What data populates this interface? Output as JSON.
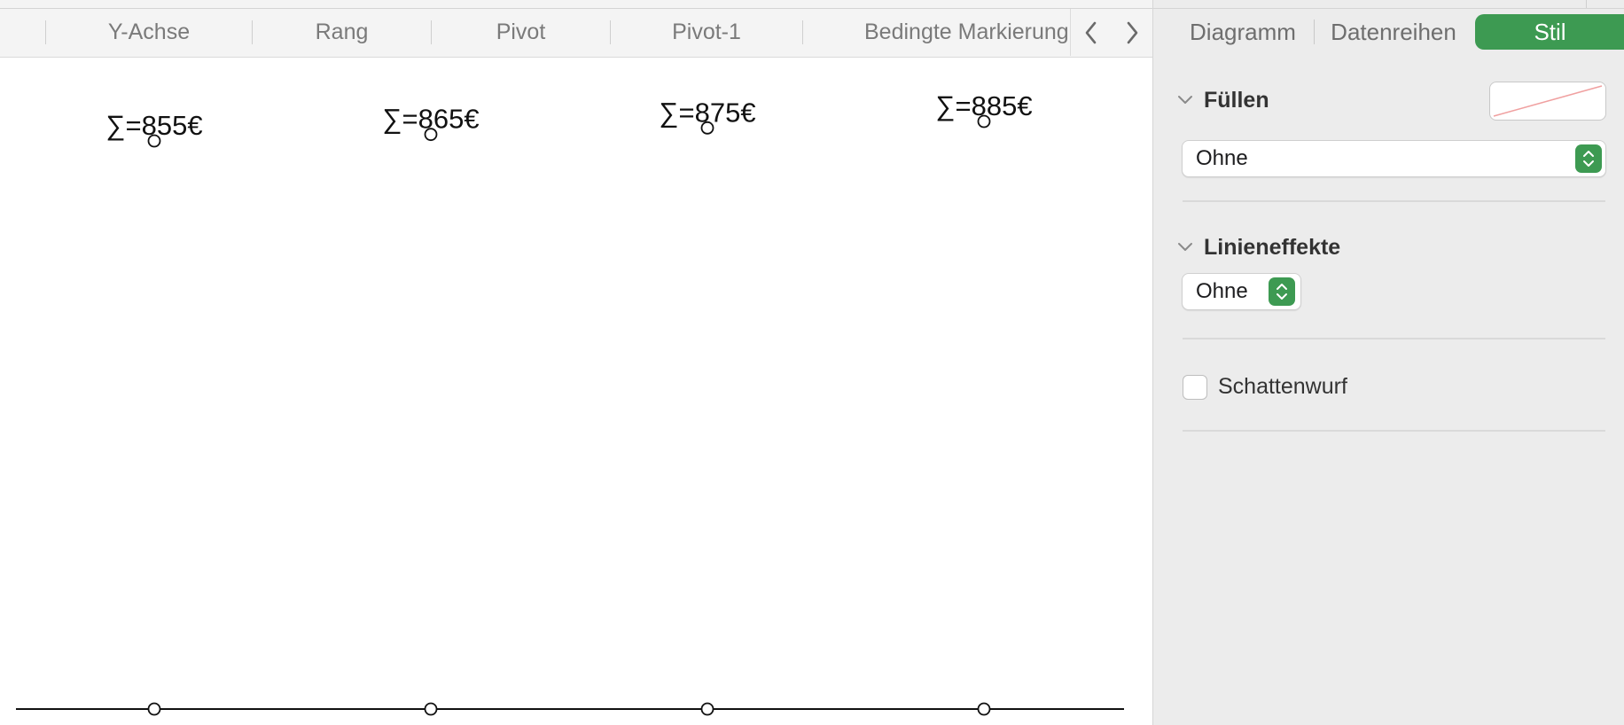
{
  "tabs": [
    {
      "label": "Y-Achse"
    },
    {
      "label": "Rang"
    },
    {
      "label": "Pivot"
    },
    {
      "label": "Pivot-1"
    },
    {
      "label": "Bedingte Markierung"
    }
  ],
  "nav": {
    "prev_icon": "chevron-left-icon",
    "next_icon": "chevron-right-icon"
  },
  "inspector": {
    "tabs": {
      "diagram": "Diagramm",
      "series": "Datenreihen",
      "style": "Stil"
    },
    "fill": {
      "label": "Füllen",
      "value": "Ohne"
    },
    "line_effects": {
      "label": "Linieneffekte",
      "value": "Ohne"
    },
    "shadow": {
      "label": "Schattenwurf",
      "checked": false
    }
  },
  "colors": {
    "accent": "#3d9a52",
    "panel": "#ececec",
    "no-fill-slash": "#f0a0a0"
  },
  "chart_data": {
    "type": "line",
    "categories": [
      "",
      "",
      "",
      ""
    ],
    "values": [
      855,
      865,
      875,
      885
    ],
    "data_labels": [
      "∑=855€",
      "∑=865€",
      "∑=875€",
      "∑=885€"
    ],
    "title": "",
    "xlabel": "",
    "ylabel": "",
    "grid": false,
    "legend": "none"
  }
}
